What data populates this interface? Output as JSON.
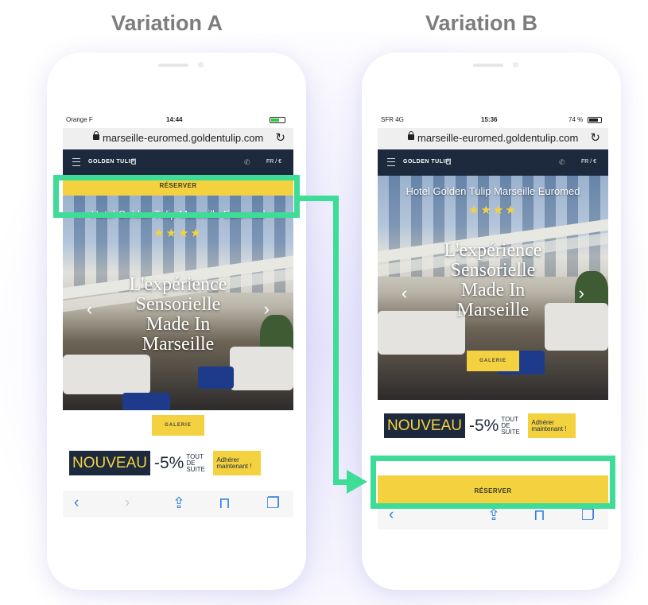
{
  "variation_a": {
    "title": "Variation A",
    "status": {
      "carrier": "Orange F",
      "time": "14:44",
      "battery": ""
    },
    "url": "marseille-euromed.goldentulip.com",
    "nav": {
      "brand": "GOLDEN TULIP",
      "lang": "FR / €"
    },
    "reserve_label": "RÉSERVER",
    "hotel_name": "Hotel Golden Tulip Marseille Euromed",
    "stars": "★★★★",
    "tagline": "L'expérience Sensorielle Made In Marseille",
    "galerie_label": "GALERIE",
    "promo": {
      "nouveau": "NOUVEAU",
      "discount": "-5%",
      "tout_de_suite": "TOUT DE SUITE",
      "adherer": "Adhérer maintenant !"
    }
  },
  "variation_b": {
    "title": "Variation B",
    "status": {
      "carrier": "SFR 4G",
      "time": "15:36",
      "battery": "74 %"
    },
    "url": "marseille-euromed.goldentulip.com",
    "nav": {
      "brand": "GOLDEN TULIP",
      "lang": "FR / €"
    },
    "reserve_label": "RÉSERVER",
    "hotel_name": "Hotel Golden Tulip Marseille Euromed",
    "stars": "★★★★",
    "tagline": "L'expérience Sensorielle Made In Marseille",
    "galerie_label": "GALERIE",
    "promo": {
      "nouveau": "NOUVEAU",
      "discount": "-5%",
      "tout_de_suite": "TOUT DE SUITE",
      "adherer": "Adhérer maintenant !"
    }
  },
  "icons": {
    "back": "‹",
    "forward": "›",
    "share": "⇪",
    "bookmarks": "⊓",
    "tabs": "❐",
    "reload": "↻"
  },
  "colors": {
    "highlight": "#3ddc97",
    "reserve": "#f4d23f",
    "navy": "#1d2a3d"
  }
}
